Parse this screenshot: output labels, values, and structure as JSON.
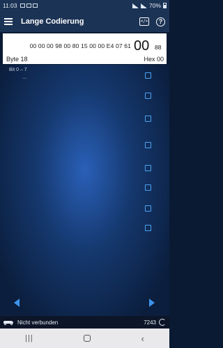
{
  "status_bar": {
    "time": "11:03",
    "battery": "70%"
  },
  "app_bar": {
    "title": "Lange Codierung",
    "menu_icon": "menu-icon",
    "code_icon": "code-icon",
    "help_icon": "help-icon"
  },
  "hex_panel": {
    "bytes_before": "00 00 00 98 00 80 15 00 00 E4 07 61",
    "current_byte": "00",
    "next_byte": "88",
    "byte_label": "Byte 18",
    "hex_label": "Hex 00"
  },
  "bits": {
    "title": "Bit 0 – 7",
    "ellipsis": "...",
    "checkboxes": [
      false,
      false,
      false,
      false,
      false,
      false,
      false,
      false
    ]
  },
  "footer": {
    "connection": "Nicht verbunden",
    "count": "7243"
  },
  "colors": {
    "accent": "#3d94ec",
    "app_bar": "#1b3354"
  }
}
